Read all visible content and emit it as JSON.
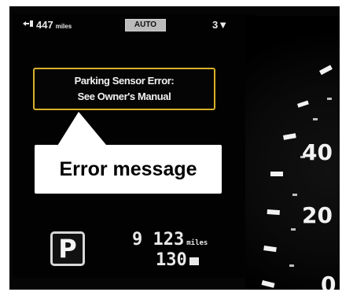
{
  "status_bar": {
    "fuel_range_value": "447",
    "fuel_range_unit": "miles",
    "drive_mode": "AUTO",
    "gear": "3▼",
    "icons": [
      "fuel-range-icon"
    ]
  },
  "warning": {
    "line1": "Parking Sensor Error:",
    "line2": "See Owner's Manual"
  },
  "callout": {
    "label": "Error message"
  },
  "transmission": {
    "gear_label": "P"
  },
  "odometer": {
    "value": "9 123",
    "unit": "miles"
  },
  "trip": {
    "value": "130"
  },
  "speedometer": {
    "visible_labels": [
      "40",
      "20",
      "0"
    ]
  },
  "colors": {
    "background": "#050505",
    "warning_border": "#d8b12a",
    "callout_fill": "#ffffff",
    "text": "#f2f2f2"
  }
}
